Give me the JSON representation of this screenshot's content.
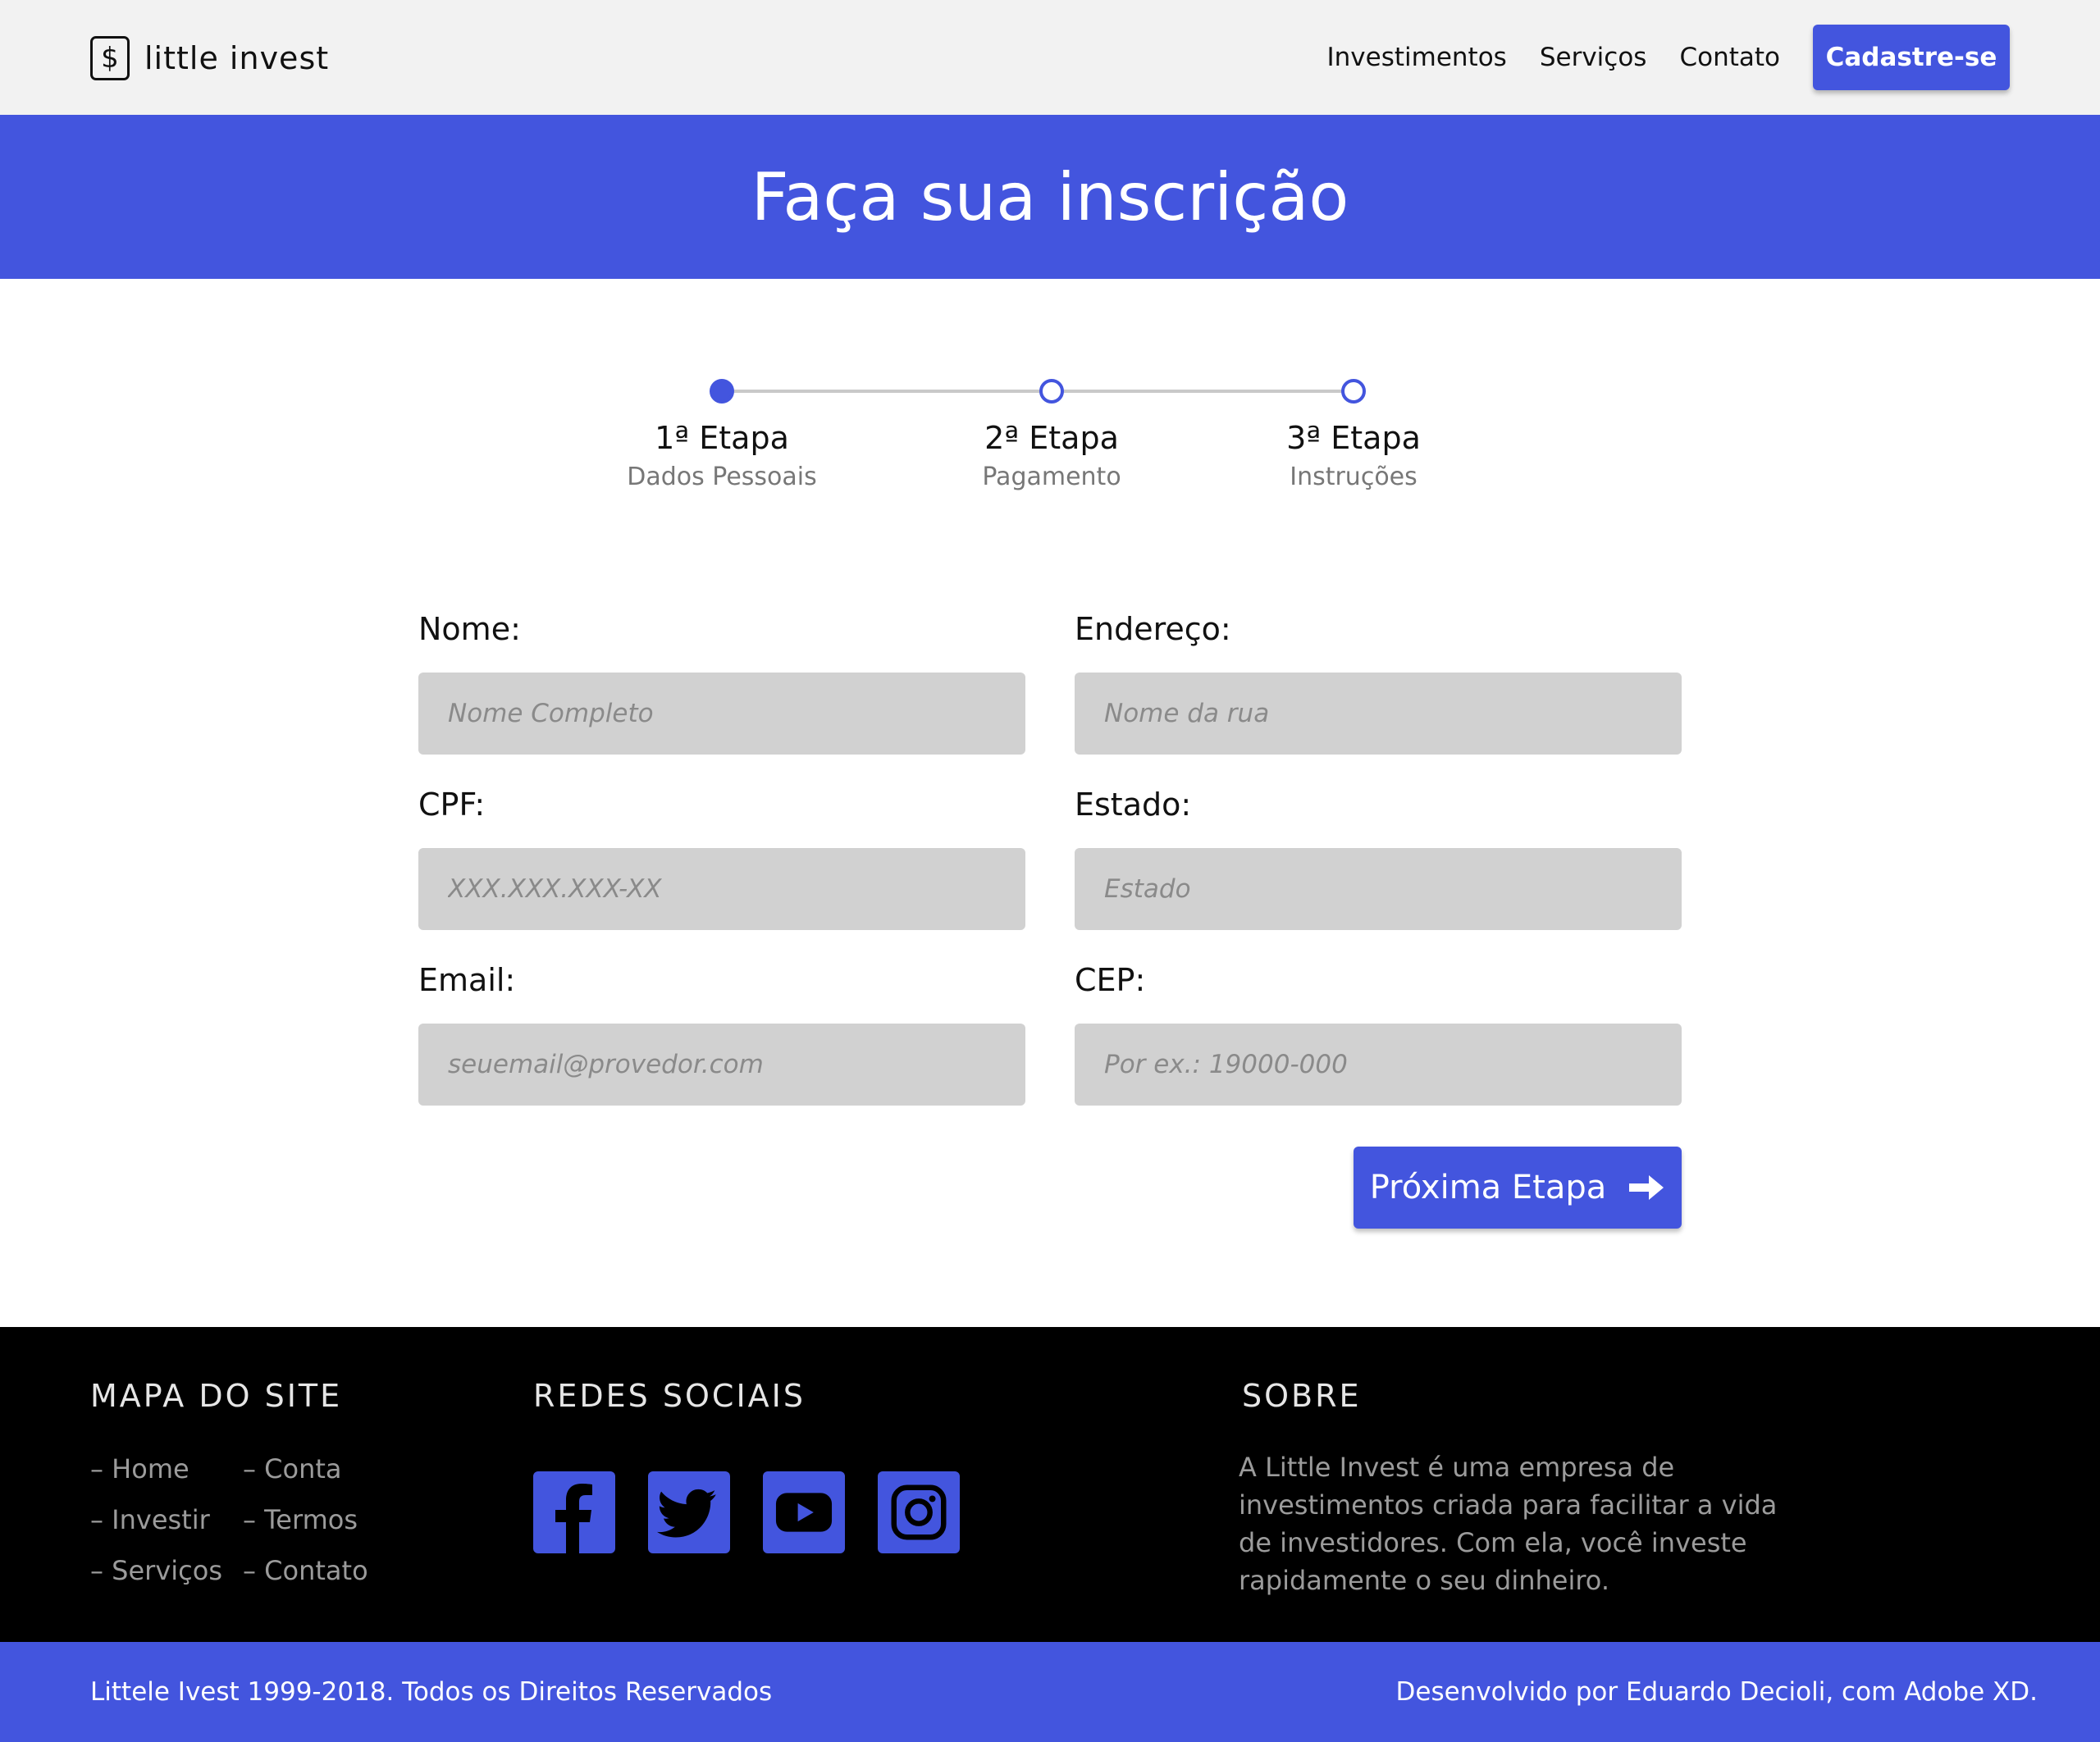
{
  "brand": {
    "icon_symbol": "$",
    "icon": "dollar-icon",
    "name": "little invest"
  },
  "nav": {
    "links": [
      "Investimentos",
      "Serviços",
      "Contato"
    ],
    "cta": "Cadastre-se"
  },
  "hero": {
    "title": "Faça sua inscrição"
  },
  "stepper": {
    "steps": [
      {
        "title": "1ª Etapa",
        "subtitle": "Dados Pessoais",
        "active": true
      },
      {
        "title": "2ª Etapa",
        "subtitle": "Pagamento",
        "active": false
      },
      {
        "title": "3ª Etapa",
        "subtitle": "Instruções",
        "active": false
      }
    ]
  },
  "form": {
    "nome": {
      "label": "Nome:",
      "placeholder": "Nome Completo",
      "value": ""
    },
    "cpf": {
      "label": "CPF:",
      "placeholder": "XXX.XXX.XXX-XX",
      "value": ""
    },
    "email": {
      "label": "Email:",
      "placeholder": "seuemail@provedor.com",
      "value": ""
    },
    "endereco": {
      "label": "Endereço:",
      "placeholder": "Nome da rua",
      "value": ""
    },
    "estado": {
      "label": "Estado:",
      "placeholder": "Estado",
      "value": ""
    },
    "cep": {
      "label": "CEP:",
      "placeholder": "Por ex.: 19000-000",
      "value": ""
    },
    "next_button": "Próxima Etapa",
    "next_icon": "arrow-right-icon"
  },
  "footer": {
    "sitemap": {
      "heading": "MAPA DO SITE",
      "col1": [
        "– Home",
        "– Investir",
        "– Serviços"
      ],
      "col2": [
        "– Conta",
        "– Termos",
        "– Contato"
      ]
    },
    "social": {
      "heading": "REDES SOCIAIS",
      "icons": [
        "facebook-icon",
        "twitter-icon",
        "youtube-icon",
        "instagram-icon"
      ]
    },
    "about": {
      "heading": "SOBRE",
      "text": "A Little Invest é uma empresa de investimentos criada para facilitar a vida de investidores. Com ela, você investe rapidamente o seu dinheiro."
    }
  },
  "bottombar": {
    "left": "Littele Ivest 1999-2018. Todos os Direitos Reservados",
    "right": "Desenvolvido por Eduardo Decioli, com Adobe XD."
  },
  "colors": {
    "accent": "#4355de",
    "navbar_bg": "#f2f2f2",
    "input_bg": "#d1d1d1",
    "footer_bg": "#000000"
  }
}
